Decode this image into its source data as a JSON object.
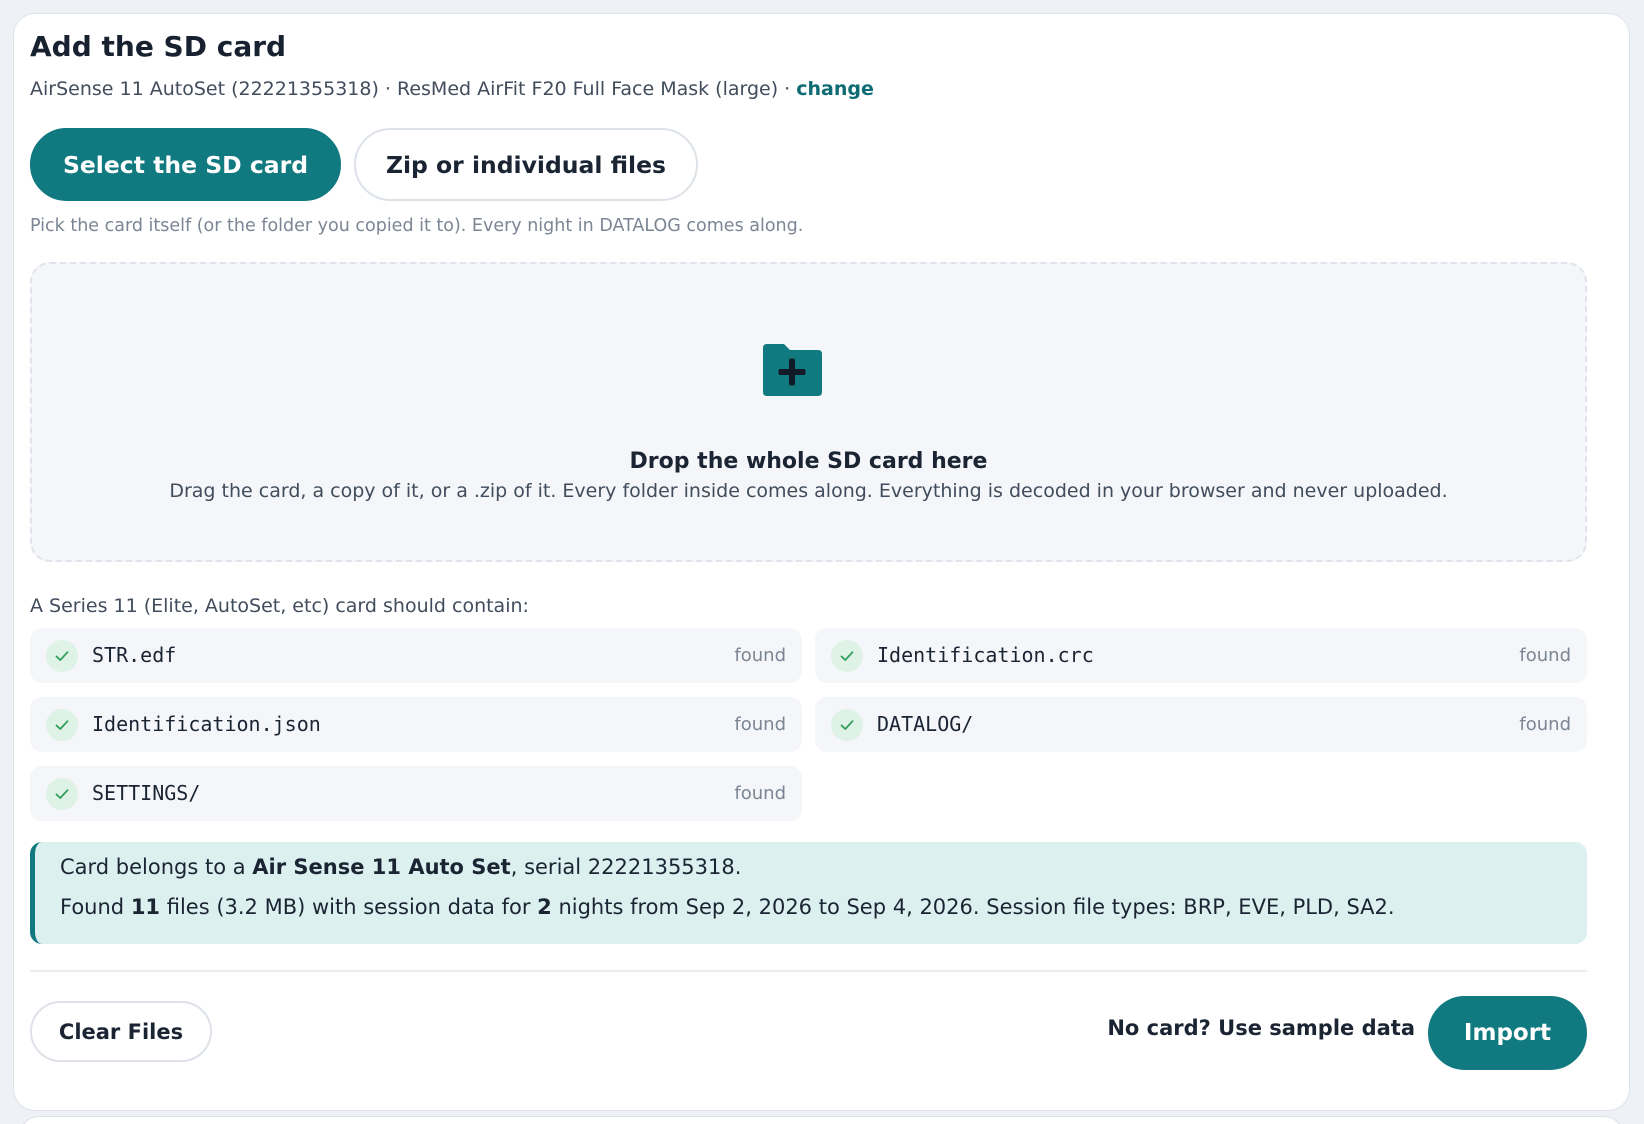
{
  "page": {
    "title": "Add the SD card",
    "device_line": "AirSense 11 AutoSet (22221355318) · ResMed AirFit F20 Full Face Mask (large) · ",
    "change_link": "change"
  },
  "source_buttons": {
    "select_label": "Select the SD card",
    "zip_label": "Zip or individual files"
  },
  "hint": "Pick the card itself (or the folder you copied it to). Every night in DATALOG comes along.",
  "dropzone": {
    "icon": "folder-plus-icon",
    "title": "Drop the whole SD card here",
    "subtitle": "Drag the card, a copy of it, or a .zip of it. Every folder inside comes along. Everything is decoded in your browser and never uploaded."
  },
  "contents": {
    "label": "A Series 11 (Elite, AutoSet, etc) card should contain:",
    "items": [
      {
        "name": "STR.edf",
        "status": "found"
      },
      {
        "name": "Identification.crc",
        "status": "found"
      },
      {
        "name": "Identification.json",
        "status": "found"
      },
      {
        "name": "DATALOG/",
        "status": "found"
      },
      {
        "name": "SETTINGS/",
        "status": "found"
      }
    ]
  },
  "info": {
    "line1_prefix": "Card belongs to a ",
    "device_name": "Air Sense 11 Auto Set",
    "line1_suffix": ", serial 22221355318.",
    "line2_a": "Found ",
    "file_count": "11",
    "line2_b": " files (3.2 MB) with session data for ",
    "night_count": "2",
    "line2_c": " nights from Sep 2, 2026 to Sep 4, 2026. Session file types: BRP, EVE, PLD, SA2."
  },
  "footer": {
    "clear_label": "Clear Files",
    "sample_label": "No card? Use sample data",
    "import_label": "Import"
  },
  "colors": {
    "accent": "#117980",
    "success": "#2f9e5a",
    "info_bg": "#dcf0f0"
  }
}
